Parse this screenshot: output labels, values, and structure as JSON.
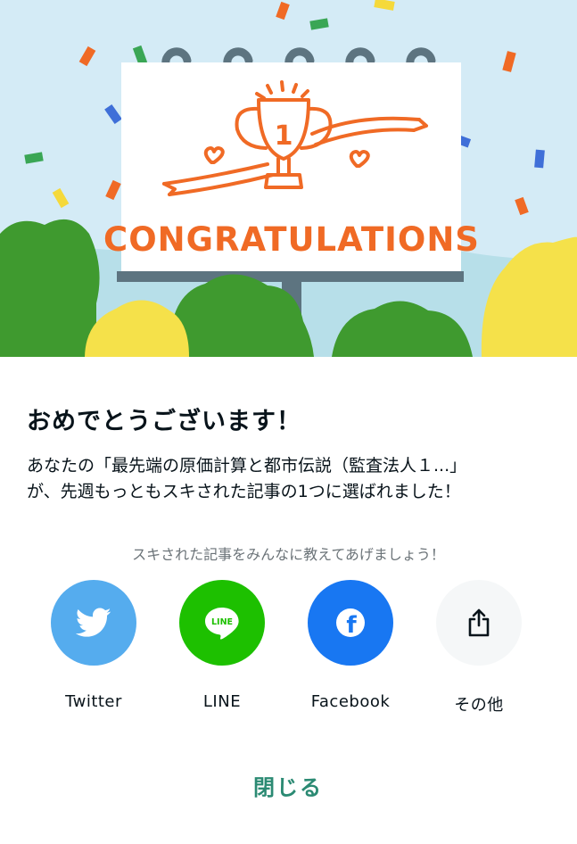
{
  "illustration": {
    "banner_text": "CONGRATULATIONS",
    "trophy_number": "1"
  },
  "dialog": {
    "title": "おめでとうございます！",
    "message_line1": "あなたの「最先端の原価計算と都市伝説（監査法人１...」",
    "message_line2": "が、先週もっともスキされた記事の1つに選ばれました！"
  },
  "share": {
    "caption": "スキされた記事をみんなに教えてあげましょう！",
    "items": [
      {
        "label": "Twitter",
        "icon": "twitter-bird-icon",
        "color": "#55acee"
      },
      {
        "label": "LINE",
        "icon": "line-logo-icon",
        "color": "#1dc000",
        "logo_text": "LINE"
      },
      {
        "label": "Facebook",
        "icon": "facebook-f-icon",
        "color": "#1877f2",
        "logo_text": "f"
      },
      {
        "label": "その他",
        "icon": "share-icon",
        "color": "#f5f7f8"
      }
    ]
  },
  "close_label": "閉じる",
  "colors": {
    "sky": "#d4ebf6",
    "accent_orange": "#f06a25",
    "close_text": "#2b8a73"
  }
}
